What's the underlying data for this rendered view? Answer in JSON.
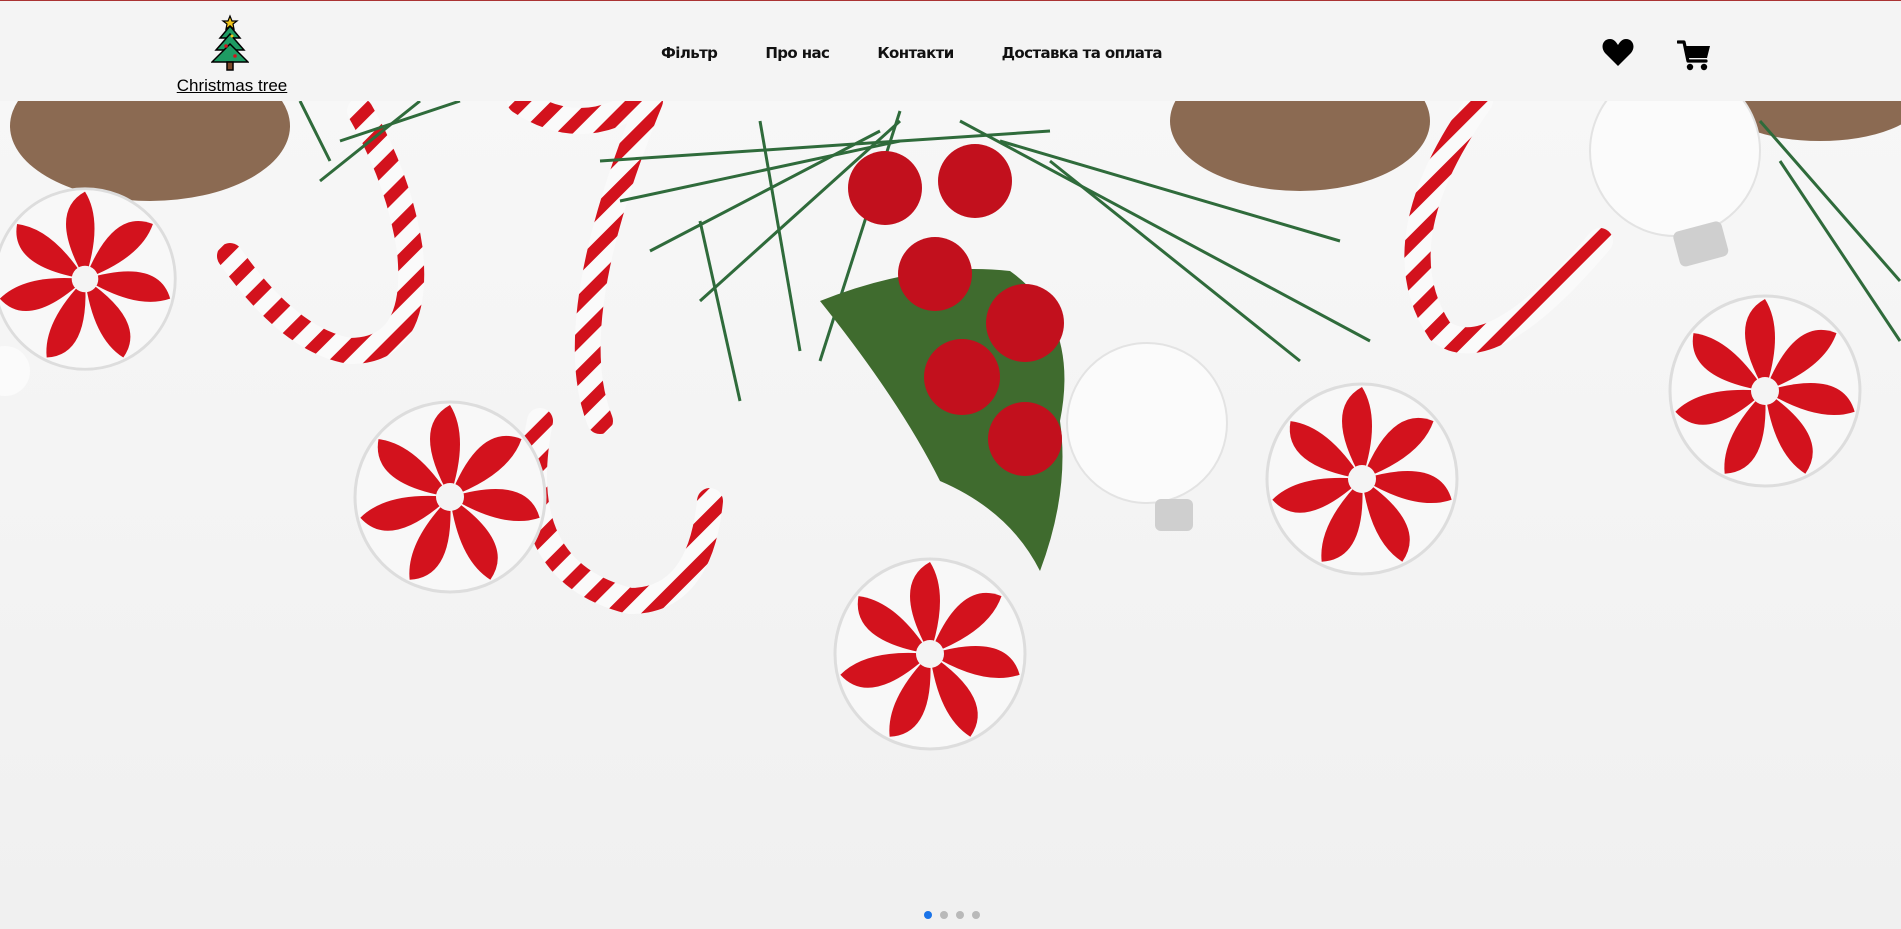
{
  "brand": {
    "name": "Christmas tree",
    "icon": "christmas-tree-icon"
  },
  "nav": {
    "items": [
      {
        "label": "Фільтр"
      },
      {
        "label": "Про нас"
      },
      {
        "label": "Контакти"
      },
      {
        "label": "Доставка та оплата"
      }
    ]
  },
  "actions": {
    "favorites_icon": "heart-icon",
    "cart_icon": "cart-icon"
  },
  "carousel": {
    "slides_count": 4,
    "active_index": 0
  },
  "colors": {
    "candy_red": "#d3121d",
    "pine_green": "#2f6b3b",
    "header_bg": "#f4f4f4",
    "dot_active": "#1a73e8"
  }
}
